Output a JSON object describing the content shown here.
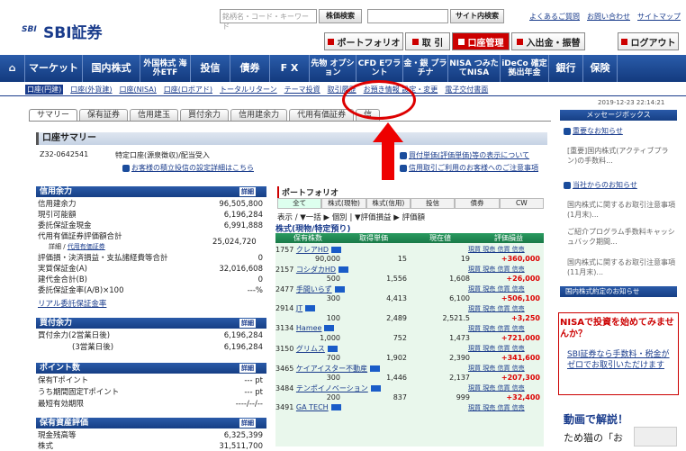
{
  "header": {
    "logo_mark": "SBI",
    "logo_name": "SBI証券",
    "search_placeholder": "銘柄名・コード・キーワード",
    "search_button": "株価検索",
    "site_search_button": "サイト内検索",
    "top_links": [
      "よくあるご質問",
      "お問い合わせ",
      "サイトマップ"
    ],
    "buttons": [
      {
        "label": "ポートフォリオ",
        "active": false
      },
      {
        "label": "取 引",
        "active": false
      },
      {
        "label": "口座管理",
        "active": true
      },
      {
        "label": "入出金・振替",
        "active": false
      }
    ],
    "logout": "ログアウト"
  },
  "nav": {
    "items": [
      "マーケット",
      "国内株式",
      "外国株式 海外ETF",
      "投信",
      "債券",
      "F X",
      "先物 オプション",
      "CFD Eワラント",
      "金・銀 プラチナ",
      "NISA つみたてNISA",
      "iDeCo 確定拠出年金",
      "銀行",
      "保険"
    ]
  },
  "subnav": {
    "items": [
      "口座(円建)",
      "口座(外貨建)",
      "口座(NISA)",
      "口座(ロボアド)",
      "トータルリターン",
      "テーマ投資",
      "取引履歴",
      "お預き情報 設定・変更",
      "電子交付書面"
    ]
  },
  "timestamp": "2019-12-23 22:14:21",
  "tabs": [
    "サマリー",
    "保有証券",
    "信用建玉",
    "買付余力",
    "信用建余力",
    "代用有価証券",
    "信"
  ],
  "summary": {
    "title": "口座サマリー",
    "account_no": "Z32-0642541",
    "account_type": "特定口座(源泉徴収)/配当受入",
    "account_link": "お客様の積立投信の設定詳細はこちら",
    "right_link_1": "買付単価(評価単価)等の表示について",
    "right_link_2": "信用取引ご利用のお客様へのご注意事項"
  },
  "credit": {
    "title": "信用余力",
    "detail": "詳細",
    "rows": [
      {
        "label": "信用建余力",
        "value": "96,505,800"
      },
      {
        "label": "現引可能額",
        "value": "6,196,284"
      },
      {
        "label": "委託保証金現金",
        "value": "6,991,888"
      },
      {
        "label": "代用有価証券評価額合計",
        "value": "25,024,720"
      },
      {
        "label": "評価損・決済損益・支払諸経費等合計",
        "value": "0"
      },
      {
        "label": "実質保証金(A)",
        "value": "32,016,608"
      },
      {
        "label": "建代金合計(B)",
        "value": "0"
      },
      {
        "label": "委託保証金率(A/B)×100",
        "value": "---%"
      }
    ],
    "detail_link": "詳細",
    "detail_link2": "代用有価証券",
    "real_link": "リアル委託保証金率"
  },
  "buying": {
    "title": "買付余力",
    "detail": "詳細",
    "rows": [
      {
        "label": "買付余力(2営業日後)",
        "value": "6,196,284"
      },
      {
        "label": "(3営業日後)",
        "value": "6,196,284"
      }
    ]
  },
  "points": {
    "title": "ポイント数",
    "detail": "詳細",
    "rows": [
      {
        "label": "保有Tポイント",
        "value": "--- pt"
      },
      {
        "label": "うち期間固定Tポイント",
        "value": "--- pt"
      },
      {
        "label": "最短有効期限",
        "value": "----/--/--"
      }
    ]
  },
  "assets": {
    "title": "保有資産評価",
    "detail": "詳細",
    "rows": [
      {
        "label": "現金残高等",
        "value": "6,325,399"
      },
      {
        "label": "株式",
        "value": "31,511,700"
      }
    ]
  },
  "portfolio": {
    "title": "ポートフォリオ",
    "tabs": [
      "全て",
      "株式(現物)",
      "株式(信用)",
      "投信",
      "債券",
      "CW"
    ],
    "controls": "表示 / ▼一括 ▶ 個別 | ▼評価損益 ▶ 評価額",
    "subtitle": "株式(現物/特定預り)",
    "head": [
      "保有株数",
      "取得単価",
      "現在値",
      "評価損益"
    ],
    "actions": "現買 現売 信買 信売",
    "rows": [
      {
        "code": "1757",
        "name": "クレアHD",
        "qty": "90,000",
        "cost": "15",
        "price": "19",
        "pl": "+360,000"
      },
      {
        "code": "2157",
        "name": "コシダカHD",
        "qty": "500",
        "cost": "1,556",
        "price": "1,608",
        "pl": "+26,000"
      },
      {
        "code": "2477",
        "name": "手間いらず",
        "qty": "300",
        "cost": "4,413",
        "price": "6,100",
        "pl": "+506,100"
      },
      {
        "code": "2914",
        "name": "JT",
        "qty": "100",
        "cost": "2,489",
        "price": "2,521.5",
        "pl": "+3,250"
      },
      {
        "code": "3134",
        "name": "Hamee",
        "qty": "1,000",
        "cost": "752",
        "price": "1,473",
        "pl": "+721,000"
      },
      {
        "code": "3150",
        "name": "グリムス",
        "qty": "700",
        "cost": "1,902",
        "price": "2,390",
        "pl": "+341,600"
      },
      {
        "code": "3465",
        "name": "ケイアイスター不動産",
        "qty": "300",
        "cost": "1,446",
        "price": "2,137",
        "pl": "+207,300"
      },
      {
        "code": "3484",
        "name": "テンポイノベーション",
        "qty": "200",
        "cost": "837",
        "price": "999",
        "pl": "+32,400"
      },
      {
        "code": "3491",
        "name": "GA TECH",
        "qty": "",
        "cost": "",
        "price": "",
        "pl": ""
      }
    ]
  },
  "sidebar": {
    "message_box": "メッセージボックス",
    "important": "重要なお知らせ",
    "important_items": [
      "[重要]国内株式(アクティブプラン)の手数料..."
    ],
    "notice": "当社からのお知らせ",
    "notice_items": [
      "国内株式に関するお取引注意事項(1月末)...",
      "ご紹介プログラム手数料キャッシュバック期間...",
      "国内株式に関するお取引注意事項(11月末)..."
    ],
    "dividend": "国内株式約定のお知らせ",
    "nisa_head": "NISAで投資を始めてみませんか？",
    "nisa_body": "SBI証券なら手数料・税金がゼロでお取引いただけます",
    "video_head": "動画で解説！",
    "video_sub": "ため猫の「お"
  }
}
